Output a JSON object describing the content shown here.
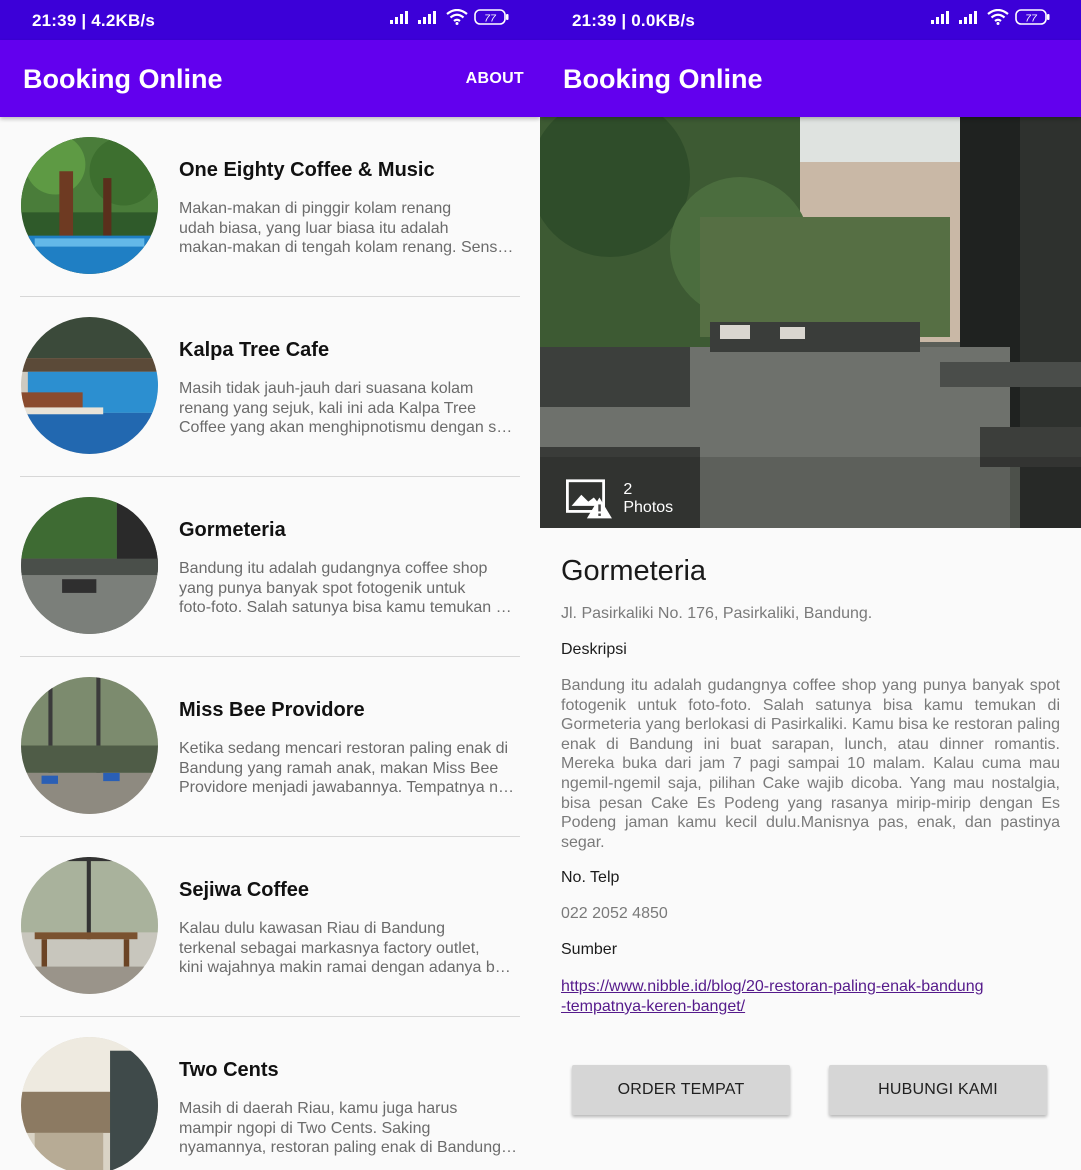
{
  "status_left": {
    "time": "21:39 | 4.2KB/s",
    "battery": "77"
  },
  "status_right": {
    "time": "21:39 | 0.0KB/s",
    "battery": "77"
  },
  "list_screen": {
    "app_title": "Booking Online",
    "about_label": "ABOUT",
    "items": [
      {
        "title": "One Eighty Coffee & Music",
        "desc": [
          "Makan-makan di pinggir kolam renang",
          "udah biasa, yang luar biasa itu adalah",
          "makan-makan di tengah kolam renang. Sens…"
        ]
      },
      {
        "title": "Kalpa Tree Cafe",
        "desc": [
          "Masih tidak jauh-jauh dari suasana kolam",
          "renang yang sejuk, kali ini ada Kalpa Tree",
          "Coffee yang akan menghipnotismu dengan s…"
        ]
      },
      {
        "title": "Gormeteria",
        "desc": [
          "Bandung itu adalah gudangnya coffee shop",
          "yang punya banyak spot fotogenik untuk",
          "foto-foto. Salah satunya bisa kamu temukan …"
        ]
      },
      {
        "title": "Miss Bee Providore",
        "desc": [
          "Ketika sedang mencari restoran paling enak di",
          "Bandung yang ramah anak, makan Miss Bee",
          "Providore menjadi jawabannya. Tempatnya n…"
        ]
      },
      {
        "title": "Sejiwa Coffee",
        "desc": [
          "Kalau dulu kawasan Riau di Bandung",
          "terkenal sebagai markasnya factory outlet,",
          "kini wajahnya makin ramai dengan adanya b…"
        ]
      },
      {
        "title": "Two Cents",
        "desc": [
          "Masih di daerah Riau, kamu juga harus",
          "mampir ngopi di Two Cents. Saking",
          "nyamannya, restoran paling enak di Bandung…"
        ]
      }
    ]
  },
  "detail_screen": {
    "app_title": "Booking Online",
    "photos_label": "2 Photos",
    "name": "Gormeteria",
    "address": "Jl. Pasirkaliki No. 176, Pasirkaliki, Bandung.",
    "desc_label": "Deskripsi",
    "description": "Bandung itu adalah gudangnya coffee shop yang punya banyak spot fotogenik untuk foto-foto. Salah satunya bisa kamu temukan di Gormeteria yang berlokasi di Pasirkaliki. Kamu bisa ke restoran paling enak di Bandung ini buat sarapan, lunch, atau dinner romantis. Mereka buka dari jam 7 pagi sampai 10 malam. Kalau cuma mau ngemil-ngemil saja, pilihan Cake wajib dicoba. Yang mau nostalgia, bisa pesan Cake Es Podeng yang rasanya mirip-mirip dengan Es Podeng jaman kamu kecil dulu.Manisnya pas, enak, dan pastinya segar.",
    "phone_label": "No. Telp",
    "phone": "022 2052 4850",
    "source_label": "Sumber",
    "source_link": [
      "https://www.nibble.id/blog/20-restoran-paling-enak-bandung",
      "-tempatnya-keren-banget/"
    ],
    "order_button": "ORDER TEMPAT",
    "contact_button": "HUBUNGI KAMI"
  },
  "colors": {
    "primary": "#6200ee",
    "status_bar": "#3c00d8",
    "link": "#551a8b",
    "button": "#d6d6d6"
  }
}
